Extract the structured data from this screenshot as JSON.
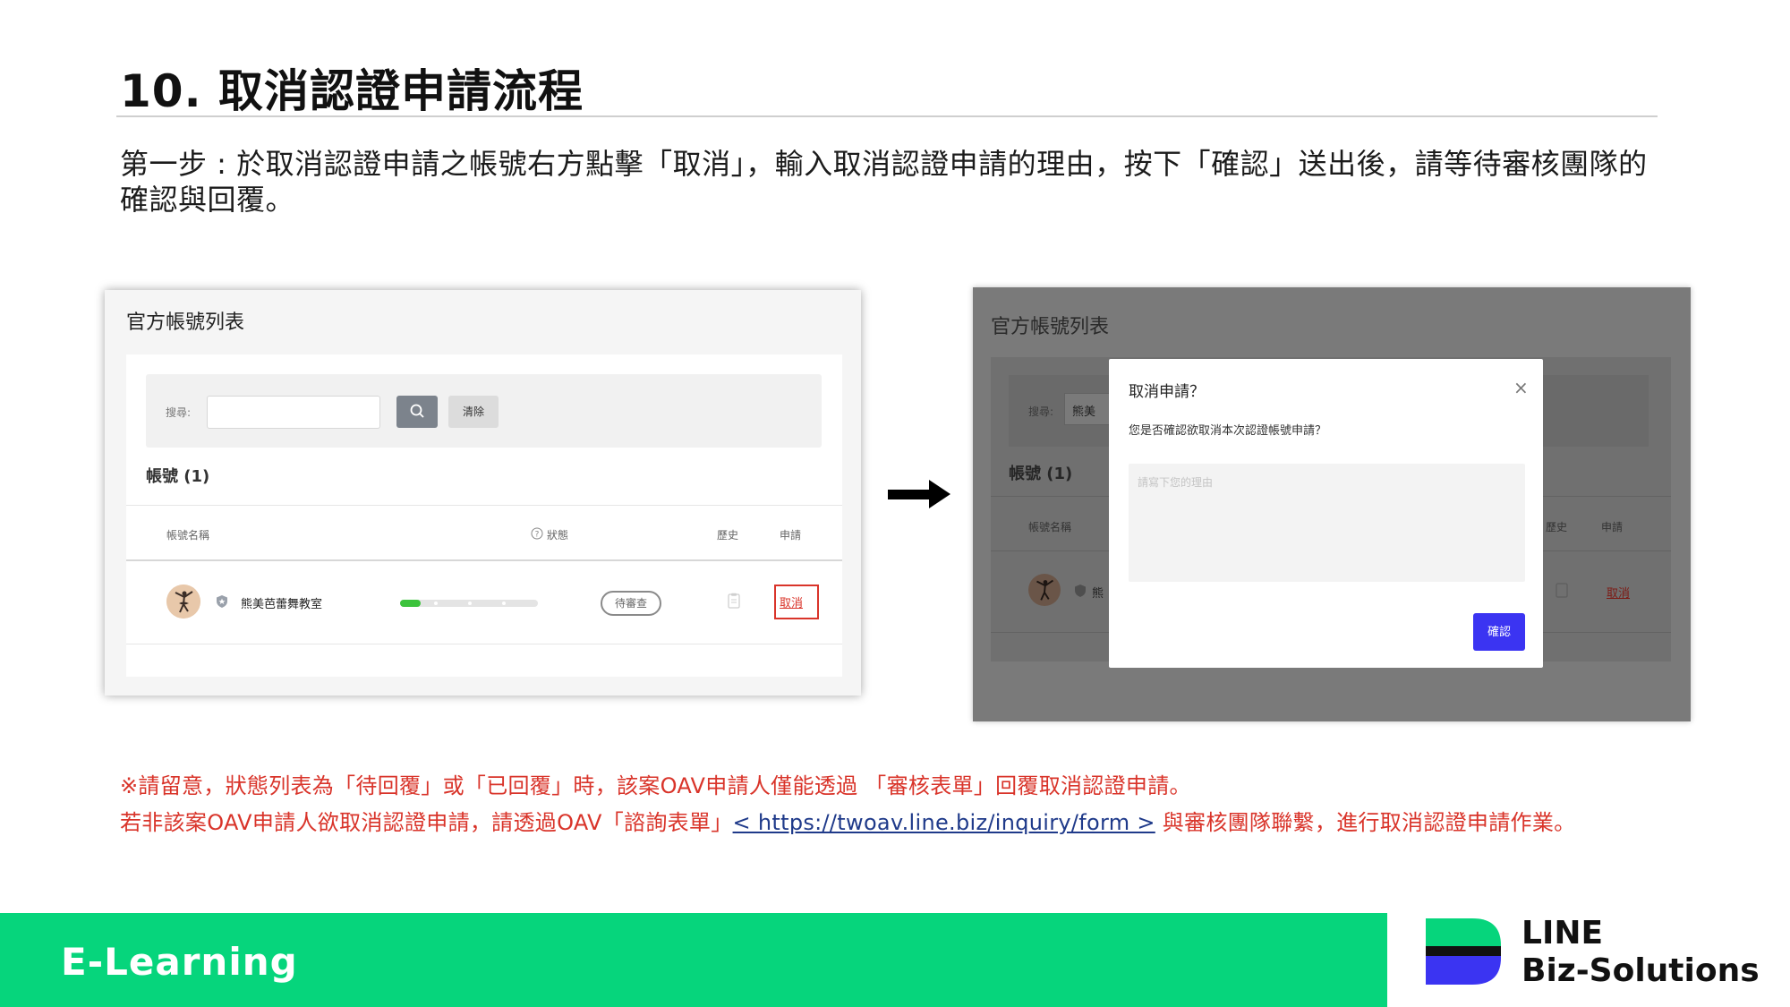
{
  "slide": {
    "title": "10. 取消認證申請流程",
    "step_text": "第一步 : 於取消認證申請之帳號右方點擊「取消」，輸入取消認證申請的理由，按下「確認」送出後，請等待審核團隊的確認與回覆。"
  },
  "left_panel": {
    "title": "官方帳號列表",
    "search_label": "搜尋:",
    "search_value": "",
    "clear_label": "清除",
    "account_heading": "帳號 (1)",
    "columns": {
      "name": "帳號名稱",
      "status": "狀態",
      "history": "歷史",
      "apply": "申請"
    },
    "row": {
      "name": "熊美芭蕾舞教室",
      "progress": 0.15,
      "status": "待審查",
      "cancel_label": "取消"
    }
  },
  "right_panel": {
    "title": "官方帳號列表",
    "search_label": "搜尋:",
    "search_value": "熊美",
    "account_heading": "帳號 (1)",
    "columns": {
      "name": "帳號名稱",
      "history": "歷史",
      "apply": "申請"
    },
    "row_name_fragment": "熊",
    "cancel_label": "取消",
    "modal": {
      "title": "取消申請？",
      "close_glyph": "×",
      "question": "您是否確認欲取消本次認證帳號申請？",
      "placeholder": "請寫下您的理由",
      "confirm_label": "確認"
    }
  },
  "notes": {
    "line1": "※請留意，狀態列表為「待回覆」或「已回覆」時，該案OAV申請人僅能透過 「審核表單」回覆取消認證申請。",
    "line2_prefix": "若非該案OAV申請人欲取消認證申請，請透過OAV「諮詢表單」",
    "line2_link": "< https://twoav.line.biz/inquiry/form >",
    "line2_suffix": " 與審核團隊聯繫，進行取消認證申請作業。"
  },
  "footer": {
    "label": "E-Learning",
    "brand_line1": "LINE",
    "brand_line2": "Biz-Solutions"
  },
  "colors": {
    "footer_green": "#06d57c",
    "warning_red": "#d9342a",
    "confirm_blue": "#3b34f2",
    "link_blue": "#1f3a8a"
  }
}
